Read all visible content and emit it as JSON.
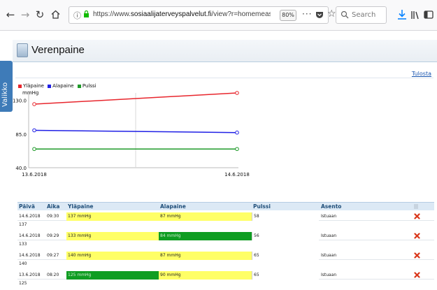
{
  "browser": {
    "url_prefix": "https://www.",
    "url_domain": "sosiaalijaterveyspalvelut.fi",
    "url_rest": "/view?r=homemeasure:bloodpre",
    "zoom": "80%",
    "search_placeholder": "Search"
  },
  "sidebar": {
    "tab_label": "Valikko"
  },
  "page": {
    "title": "Verenpaine",
    "print_link": "Tulosta"
  },
  "chart_data": {
    "type": "line",
    "title": "",
    "ylabel": "mmHg",
    "ylim": [
      40,
      140
    ],
    "yticks": [
      "130.0",
      "85.0",
      "40.0"
    ],
    "categories": [
      "13.6.2018",
      "14.6.2018"
    ],
    "series": [
      {
        "name": "Yläpaine",
        "color": "#e8262d",
        "values": [
          125,
          140
        ]
      },
      {
        "name": "Alapaine",
        "color": "#2020e6",
        "values": [
          90,
          87
        ]
      },
      {
        "name": "Pulssi",
        "color": "#1f9a2a",
        "values": [
          65,
          65
        ]
      }
    ]
  },
  "table": {
    "headers": [
      "Päivä",
      "Aika",
      "Yläpaine",
      "Alapaine",
      "Pulssi",
      "Asento"
    ],
    "rows": [
      {
        "date": "14.6.2018",
        "time": "09:30",
        "systolic": "137 mmHg",
        "sys_color": "yellow",
        "diastolic": "87 mmHg",
        "dia_color": "yellow",
        "pulse": "58",
        "position": "Istuaan",
        "note": "137"
      },
      {
        "date": "14.6.2018",
        "time": "09:29",
        "systolic": "133 mmHg",
        "sys_color": "yellow",
        "diastolic": "84 mmHg",
        "dia_color": "green",
        "pulse": "56",
        "position": "Istuaan",
        "note": "133"
      },
      {
        "date": "14.6.2018",
        "time": "09:27",
        "systolic": "140 mmHg",
        "sys_color": "yellow",
        "diastolic": "87 mmHg",
        "dia_color": "yellow",
        "pulse": "65",
        "position": "Istuaan",
        "note": "140"
      },
      {
        "date": "13.6.2018",
        "time": "08:20",
        "systolic": "125 mmHg",
        "sys_color": "green",
        "diastolic": "90 mmHg",
        "dia_color": "yellow",
        "pulse": "65",
        "position": "Istuaan",
        "note": "125"
      }
    ]
  }
}
